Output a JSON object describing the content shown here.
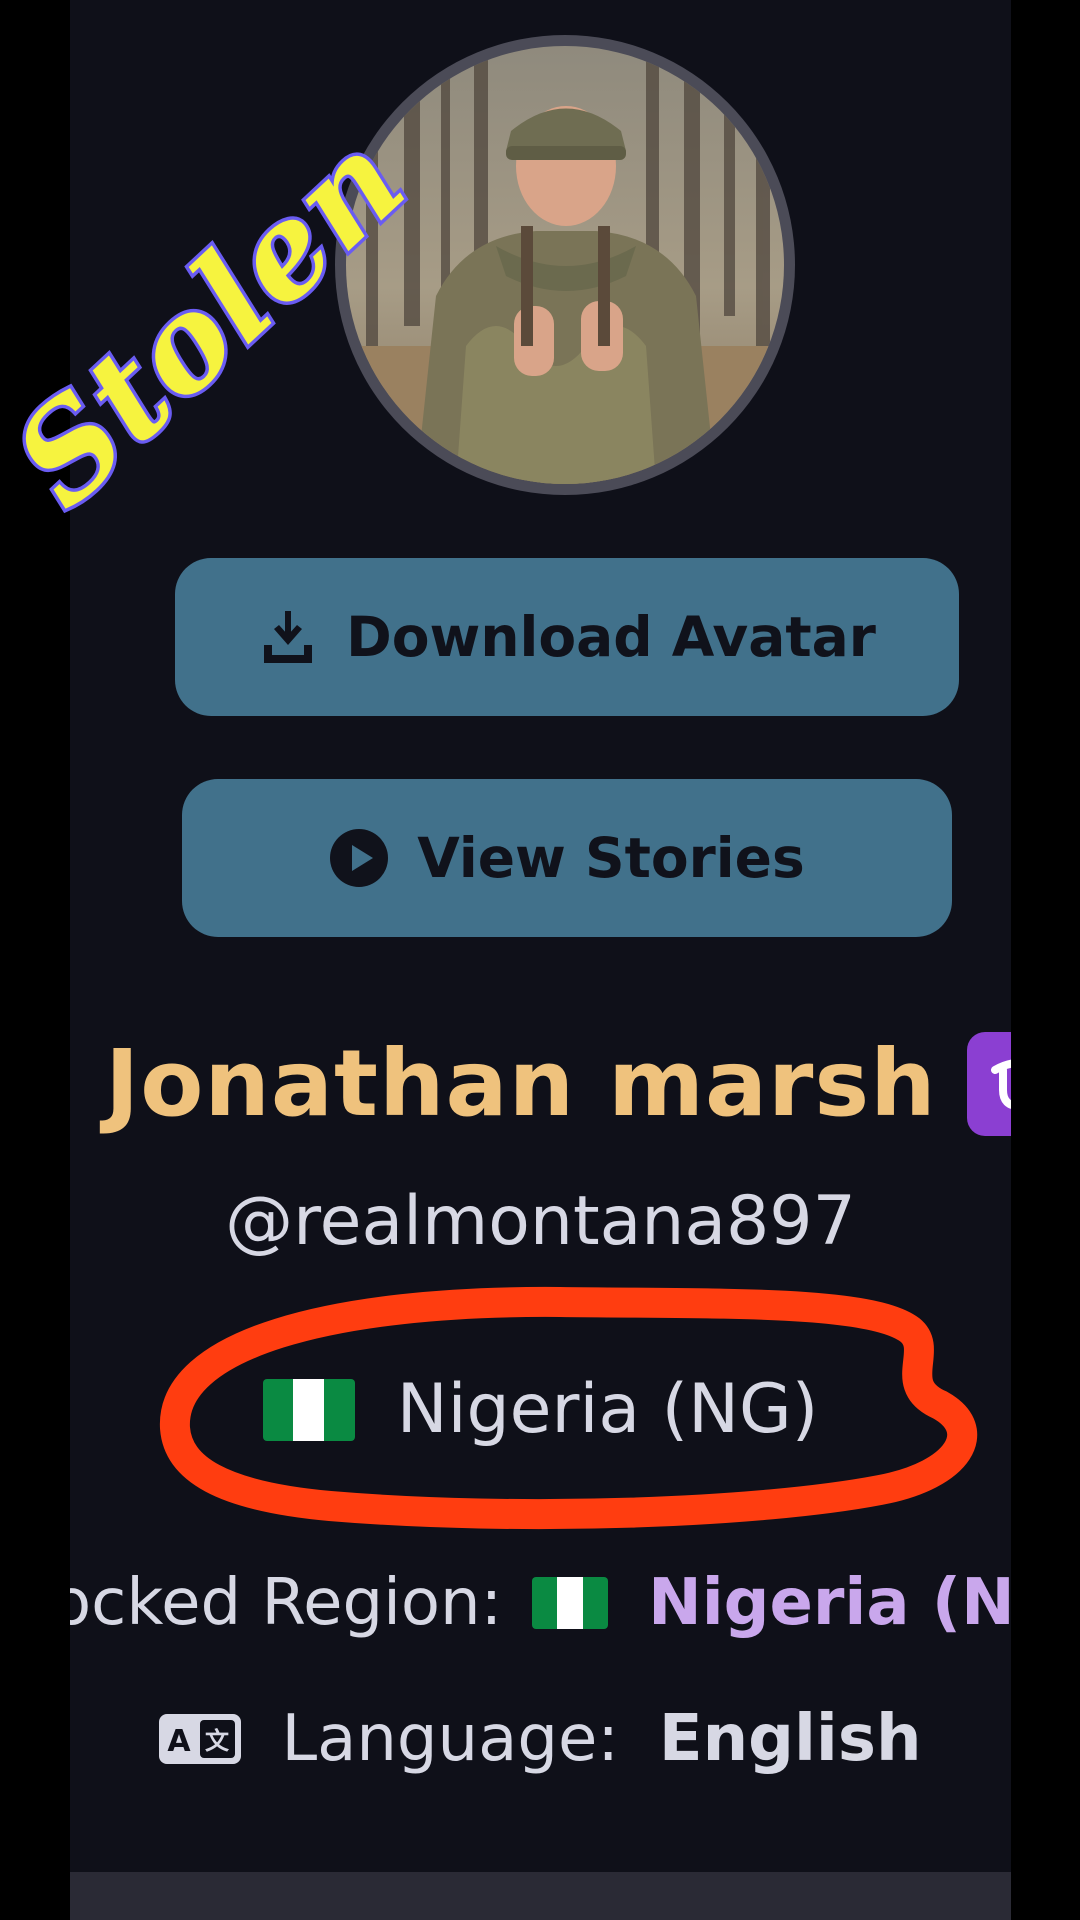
{
  "profile": {
    "display_name": "Jonathan marsh",
    "zodiac_badge_icon": "ophiuchus-icon",
    "handle": "@realmontana897",
    "country": "Nigeria (NG)",
    "country_flag_icon": "nigeria-flag-icon"
  },
  "actions": {
    "download_label": "Download Avatar",
    "download_icon": "download-icon",
    "stories_label": "View Stories",
    "stories_icon": "play-circle-icon"
  },
  "details": {
    "region_label": "ocked Region:",
    "region_value": "Nigeria (N",
    "language_label": "Language:",
    "language_value": "English",
    "language_icon": "translate-icon"
  },
  "overlay": {
    "watermark_text": "Stolen",
    "annotation": "red-circle-highlight"
  },
  "colors": {
    "background": "#0f1019",
    "button": "#41718b",
    "name": "#efc27d",
    "region_value": "#c9a7ec",
    "annotation_red": "#ff3d10",
    "watermark_fill": "#f6f33f",
    "watermark_outline": "#6a5cf2"
  }
}
